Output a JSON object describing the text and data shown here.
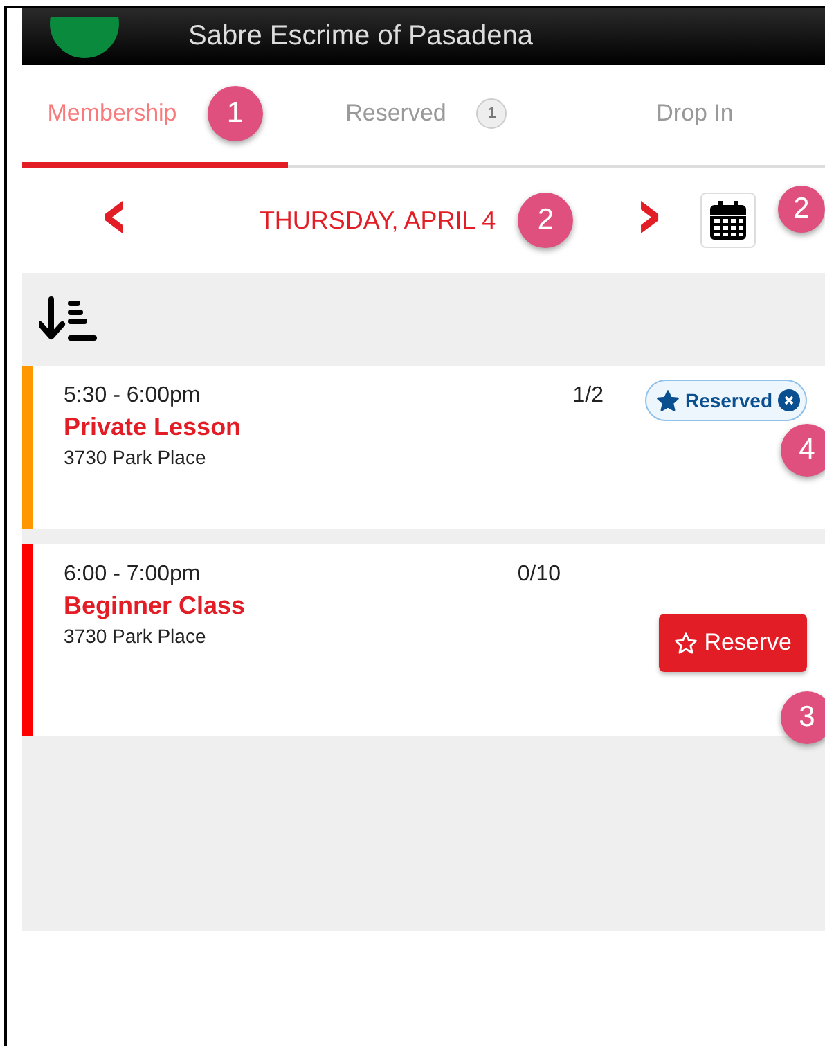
{
  "header": {
    "title": "Sabre Escrime of Pasadena"
  },
  "tabs": [
    {
      "label": "Membership",
      "selected": true,
      "annotation": "1"
    },
    {
      "label": "Reserved",
      "selected": false,
      "count": "1"
    },
    {
      "label": "Drop In",
      "selected": false
    }
  ],
  "date_bar": {
    "prev": "‹",
    "date": "THURSDAY, APRIL 4",
    "date_annotation": "2",
    "next": "›",
    "calendar_annotation": "2"
  },
  "classes": [
    {
      "time": "5:30 - 6:00pm",
      "spots": "1/2",
      "title": "Private Lesson",
      "location": "3730 Park Place",
      "color": "#ff9800",
      "kind": "reserved",
      "action": "Reserved",
      "annotation": "4"
    },
    {
      "time": "6:00 - 7:00pm",
      "spots": "0/10",
      "title": "Beginner Class",
      "location": "3730 Park Place",
      "color": "#ff0000",
      "kind": "reserve",
      "action": "Reserve",
      "annotation": "3"
    }
  ]
}
